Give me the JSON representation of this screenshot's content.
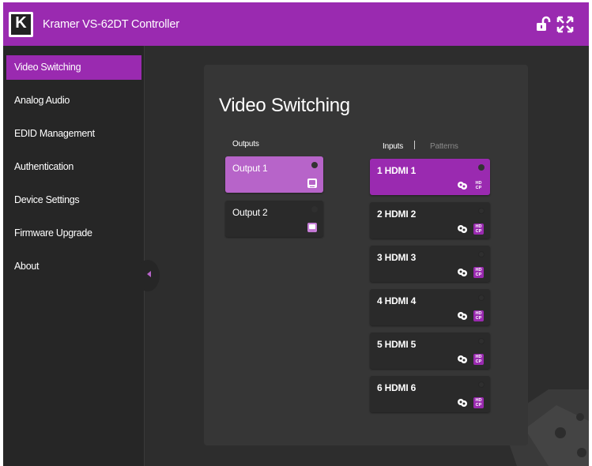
{
  "header": {
    "logo_letter": "K",
    "title": "Kramer VS-62DT Controller",
    "icons": [
      "unlock-icon",
      "fullscreen-icon"
    ]
  },
  "sidebar": {
    "items": [
      {
        "label": "Video Switching",
        "active": true
      },
      {
        "label": "Analog Audio"
      },
      {
        "label": "EDID Management"
      },
      {
        "label": "Authentication"
      },
      {
        "label": "Device Settings"
      },
      {
        "label": "Firmware Upgrade"
      },
      {
        "label": "About"
      }
    ]
  },
  "main": {
    "title": "Video Switching",
    "outputs_label": "Outputs",
    "inputs_label": "Inputs",
    "patterns_label": "Patterns",
    "outputs": [
      {
        "label": "Output 1",
        "selected": true
      },
      {
        "label": "Output 2"
      }
    ],
    "inputs": [
      {
        "label": "1 HDMI 1",
        "selected": true
      },
      {
        "label": "2 HDMI 2"
      },
      {
        "label": "3 HDMI 3"
      },
      {
        "label": "4 HDMI 4"
      },
      {
        "label": "5 HDMI 5"
      },
      {
        "label": "6 HDMI 6"
      }
    ],
    "hdcp_line1": "HD",
    "hdcp_line2": "CP"
  },
  "colors": {
    "accent": "#9a2ab0",
    "output_selected": "#b764c9",
    "background": "#2c2c2c"
  }
}
